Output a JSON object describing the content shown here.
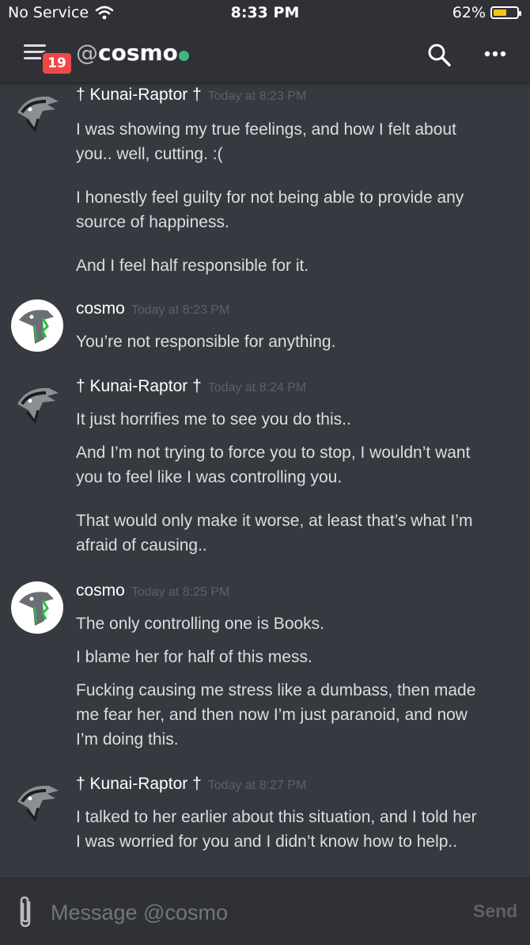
{
  "status_bar": {
    "carrier": "No Service",
    "time": "8:33 PM",
    "battery_percent_label": "62%",
    "battery_level": 0.62,
    "battery_color": "#f5c518"
  },
  "header": {
    "menu_icon": "hamburger-menu-icon",
    "badge_count": "19",
    "channel_prefix": "@",
    "channel_name": "cosmo",
    "status_color": "#43b581",
    "search_icon": "search-icon",
    "more_icon": "more-icon"
  },
  "messages": [
    {
      "author": "† Kunai-Raptor †",
      "timestamp": "Today at 8:23 PM",
      "avatar": "raptor-avatar",
      "lines": [
        "I was showing my true feelings, and how I felt about",
        "you.. well, cutting. :(",
        "I honestly feel guilty for not being able to provide any",
        "source of happiness.",
        "And I feel half responsible for it."
      ]
    },
    {
      "author": "cosmo",
      "timestamp": "Today at 8:23 PM",
      "avatar": "cosmo-avatar",
      "lines": [
        "You’re not responsible for anything."
      ]
    },
    {
      "author": "† Kunai-Raptor †",
      "timestamp": "Today at 8:24 PM",
      "avatar": "raptor-avatar",
      "lines": [
        "It just horrifies me to see you do this..",
        "And I’m not trying to force you to stop, I wouldn’t want",
        "you to feel like I was controlling you.",
        "That would only make it worse, at least that’s what I’m",
        "afraid of causing.."
      ]
    },
    {
      "author": "cosmo",
      "timestamp": "Today at 8:25 PM",
      "avatar": "cosmo-avatar",
      "lines": [
        "The only controlling one is Books.",
        "I blame her for half of this mess.",
        "Fucking causing me stress like a dumbass, then made",
        "me fear her, and then now I’m just paranoid, and now",
        "I’m doing this."
      ]
    },
    {
      "author": "† Kunai-Raptor †",
      "timestamp": "Today at 8:27 PM",
      "avatar": "raptor-avatar",
      "lines": [
        "I talked to her earlier about this situation, and I told her",
        "I was worried for you and I didn’t know how to help.."
      ]
    }
  ],
  "composer": {
    "attach_icon": "paperclip-icon",
    "placeholder": "Message @cosmo",
    "value": "",
    "send_label": "Send"
  }
}
